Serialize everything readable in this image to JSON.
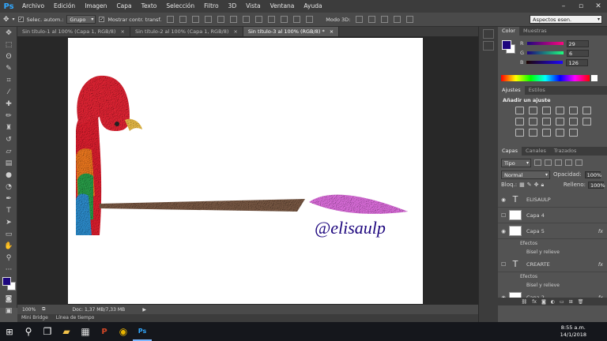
{
  "app": {
    "logo": "Ps"
  },
  "menu": [
    "Archivo",
    "Edición",
    "Imagen",
    "Capa",
    "Texto",
    "Selección",
    "Filtro",
    "3D",
    "Vista",
    "Ventana",
    "Ayuda"
  ],
  "options": {
    "autoselect_label": "Selec. autom.:",
    "autoselect_value": "Grupo",
    "transform_label": "Mostrar contr. transf.",
    "mode3d_label": "Modo 3D:",
    "workspace": "Aspectos esen."
  },
  "doc_tabs": [
    {
      "label": "Sin título-1 al 100% (Capa 1, RGB/8)",
      "close": "×"
    },
    {
      "label": "Sin título-2 al 100% (Capa 1, RGB/8)",
      "close": "×"
    },
    {
      "label": "Sin título-3 al 100% (RGB/8) *",
      "close": "×"
    }
  ],
  "canvas": {
    "signature": "@elisaulp"
  },
  "status": {
    "zoom": "100%",
    "doc": "Doc: 1,37 MB/7,33 MB"
  },
  "bottom_tabs": [
    "Mini Bridge",
    "Línea de tiempo"
  ],
  "color_panel": {
    "tabs": [
      "Color",
      "Muestras"
    ],
    "channels": [
      {
        "label": "R",
        "value": "29"
      },
      {
        "label": "G",
        "value": "6"
      },
      {
        "label": "B",
        "value": "126"
      }
    ],
    "foreground": "#1d067e"
  },
  "adjust_panel": {
    "tabs": [
      "Ajustes",
      "Estilos"
    ],
    "title": "Añadir un ajuste"
  },
  "layers_panel": {
    "tabs": [
      "Capas",
      "Canales",
      "Trazados"
    ],
    "filter_label": "Tipo",
    "blend_mode": "Normal",
    "opacity_label": "Opacidad:",
    "opacity_value": "100%",
    "lock_label": "Bloq.:",
    "fill_label": "Relleno:",
    "fill_value": "100%",
    "layers": [
      {
        "name": "ELISAULP",
        "type": "text",
        "visible": true
      },
      {
        "name": "Capa 4",
        "type": "pixel",
        "visible": false
      },
      {
        "name": "Capa 5",
        "type": "pixel",
        "visible": true,
        "fx": true,
        "effects_label": "Efectos",
        "effect": "Bisel y relieve"
      },
      {
        "name": "CREARTE",
        "type": "text",
        "visible": false,
        "fx": true,
        "effects_label": "Efectos",
        "effect": "Bisel y relieve"
      },
      {
        "name": "Capa 2",
        "type": "pixel",
        "visible": true,
        "fx": true,
        "effects_label": "Efectos",
        "effect": "Bisel y relieve"
      }
    ]
  },
  "taskbar": {
    "time": "8:55 a.m.",
    "date": "14/1/2018"
  }
}
